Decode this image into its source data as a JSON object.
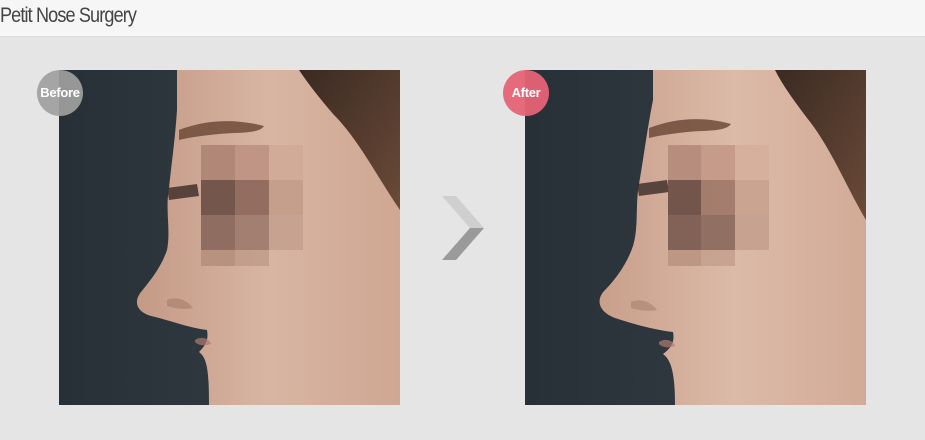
{
  "page": {
    "title": "Petit Nose Surgery"
  },
  "comparison": {
    "before": {
      "badge_label": "Before",
      "badge_color": "#a0a0a0"
    },
    "after": {
      "badge_label": "After",
      "badge_color": "#e56376"
    }
  },
  "divider_icon": "chevron-right-icon"
}
